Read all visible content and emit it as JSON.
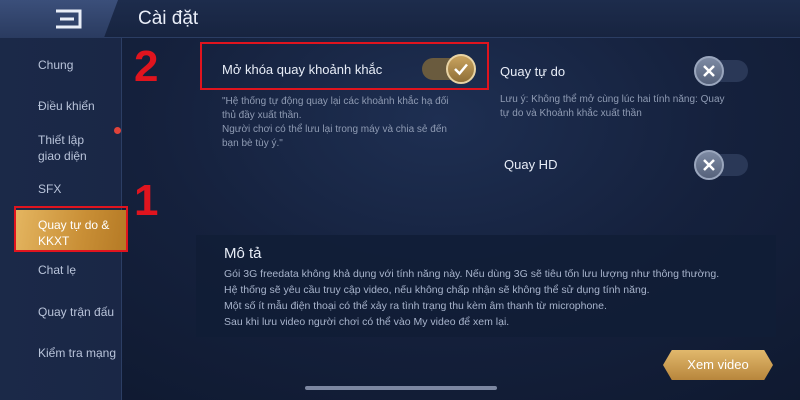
{
  "header": {
    "title": "Cài đặt",
    "back_icon": "back-arrow-icon"
  },
  "sidebar": {
    "items": [
      {
        "label": "Chung"
      },
      {
        "label": "Điều khiển"
      },
      {
        "label": "Thiết lập giao diện"
      },
      {
        "label": "SFX"
      },
      {
        "label": "Quay tự do & KKXT"
      },
      {
        "label": "Chat lẹ"
      },
      {
        "label": "Quay trận đấu"
      },
      {
        "label": "Kiểm tra mạng"
      }
    ],
    "active_index": 4
  },
  "annotations": {
    "step1": "1",
    "step2": "2",
    "color": "#e0141e"
  },
  "settings": {
    "unlock_moments": {
      "label": "Mở khóa quay khoảnh khắc",
      "enabled": true,
      "note_lines": [
        "\"Hệ thống tự động quay lại các khoảnh khắc hạ đối",
        "thủ đầy xuất thần.",
        "Người chơi có thể lưu lại trong máy và chia sẻ đến",
        "bạn bè tùy ý.\""
      ]
    },
    "free_record": {
      "label": "Quay tự do",
      "enabled": false,
      "note_lines": [
        "Lưu ý: Không thể mở cùng lúc hai tính năng: Quay",
        "tự do và Khoảnh khắc xuất thần"
      ]
    },
    "hd_record": {
      "label": "Quay HD",
      "enabled": false
    }
  },
  "description": {
    "title": "Mô tả",
    "lines": [
      "Gói 3G freedata không khả dụng với tính năng này. Nếu dùng 3G sẽ tiêu tốn lưu lượng như thông thường.",
      "Hệ thống sẽ yêu cầu truy cập video, nếu không chấp nhận sẽ không thể sử dụng tính năng.",
      "Một số ít mẫu điện thoại có thể xảy ra tình trạng thu kèm âm thanh từ microphone.",
      "Sau khi lưu video người chơi có thể vào My video để xem lại."
    ]
  },
  "video_button": {
    "label": "Xem video"
  },
  "colors": {
    "accent": "#c9a35f",
    "background": "#15213d",
    "active_tab": "#d9a54d"
  }
}
